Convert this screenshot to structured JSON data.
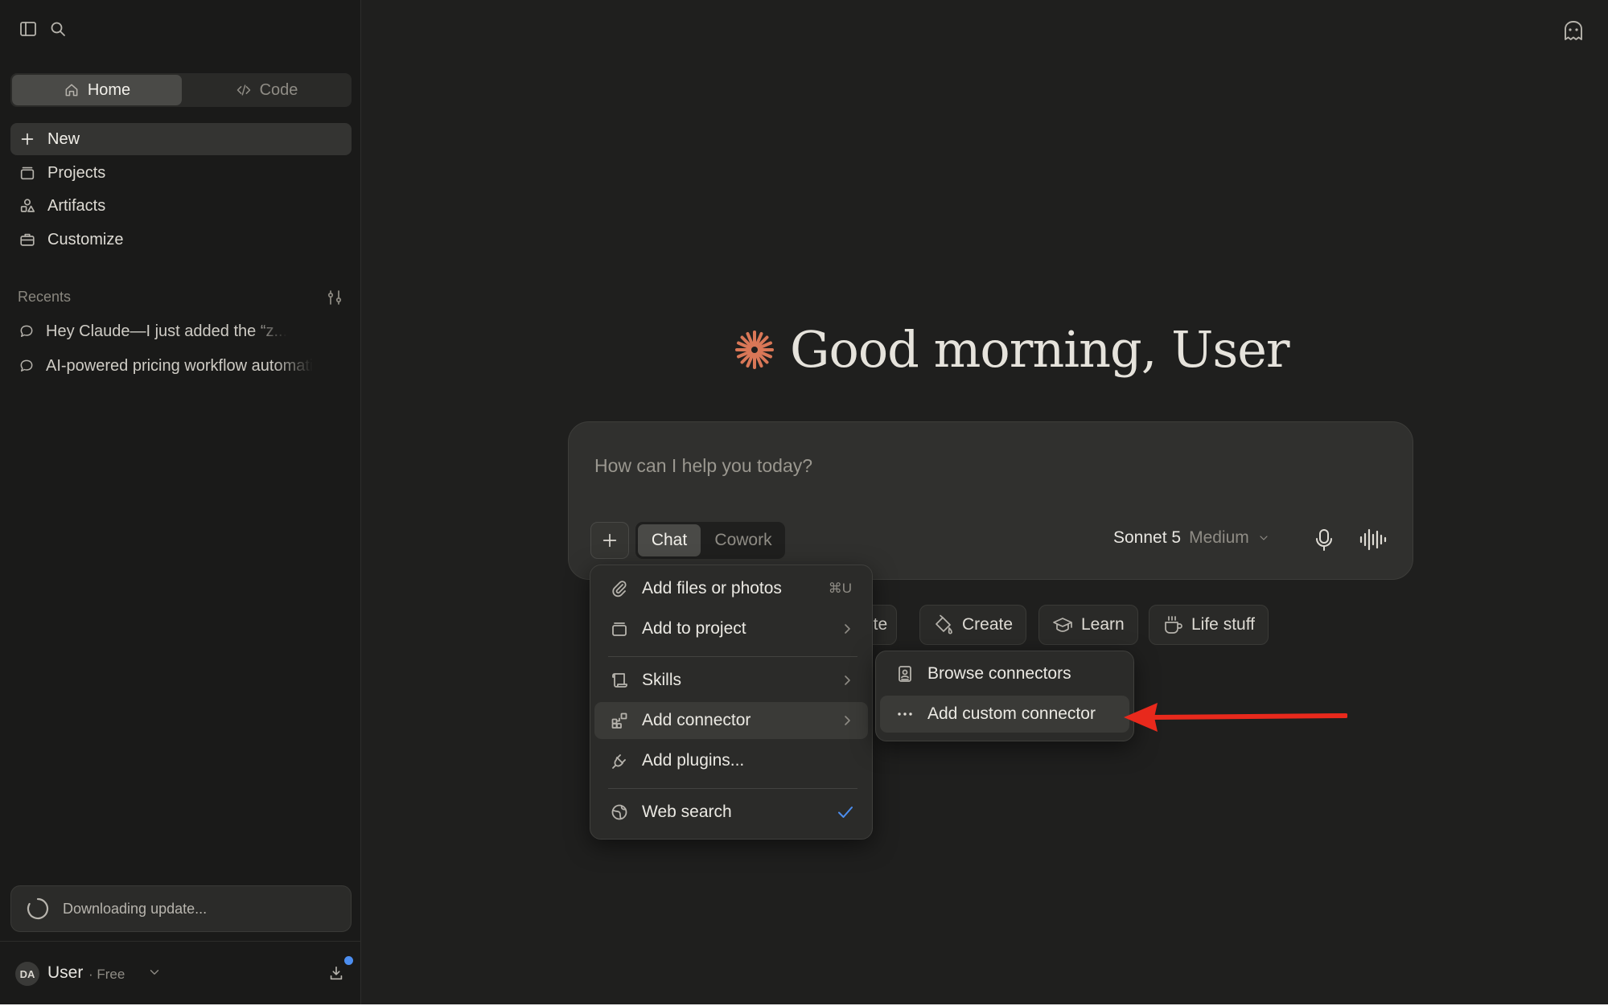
{
  "sidebar": {
    "mode_tabs": [
      {
        "label": "Home",
        "icon": "home-icon",
        "active": true
      },
      {
        "label": "Code",
        "icon": "code-icon",
        "active": false
      }
    ],
    "nav": [
      {
        "label": "New",
        "icon": "plus-icon"
      },
      {
        "label": "Projects",
        "icon": "folder-icon"
      },
      {
        "label": "Artifacts",
        "icon": "artifacts-icon"
      },
      {
        "label": "Customize",
        "icon": "briefcase-icon"
      }
    ],
    "recents_label": "Recents",
    "recents": [
      {
        "label": "Hey Claude—I just added the “z..."
      },
      {
        "label": "AI-powered pricing workflow automati"
      }
    ],
    "update_status": "Downloading update...",
    "user": {
      "initials": "DA",
      "name": "User",
      "plan": "· Free"
    }
  },
  "main": {
    "greeting": "Good morning, User",
    "composer": {
      "placeholder": "How can I help you today?",
      "mode_chat": "Chat",
      "mode_cowork": "Cowork",
      "model_name": "Sonnet 5",
      "model_effort": "Medium"
    },
    "chips": [
      {
        "label": "ite"
      },
      {
        "label": "Create"
      },
      {
        "label": "Learn"
      },
      {
        "label": "Life stuff"
      }
    ],
    "plus_menu": [
      {
        "label": "Add files or photos",
        "shortcut": "⌘U"
      },
      {
        "label": "Add to project"
      },
      {
        "label": "Skills"
      },
      {
        "label": "Add connector"
      },
      {
        "label": "Add plugins..."
      },
      {
        "label": "Web search",
        "checked": true
      }
    ],
    "connector_submenu": [
      {
        "label": "Browse connectors"
      },
      {
        "label": "Add custom connector"
      }
    ]
  },
  "colors": {
    "background": "#1f1f1e",
    "sidebar": "#1a1a19",
    "accent_spark": "#d97757",
    "annotation_arrow": "#e8291c",
    "check": "#4c8ef0"
  }
}
